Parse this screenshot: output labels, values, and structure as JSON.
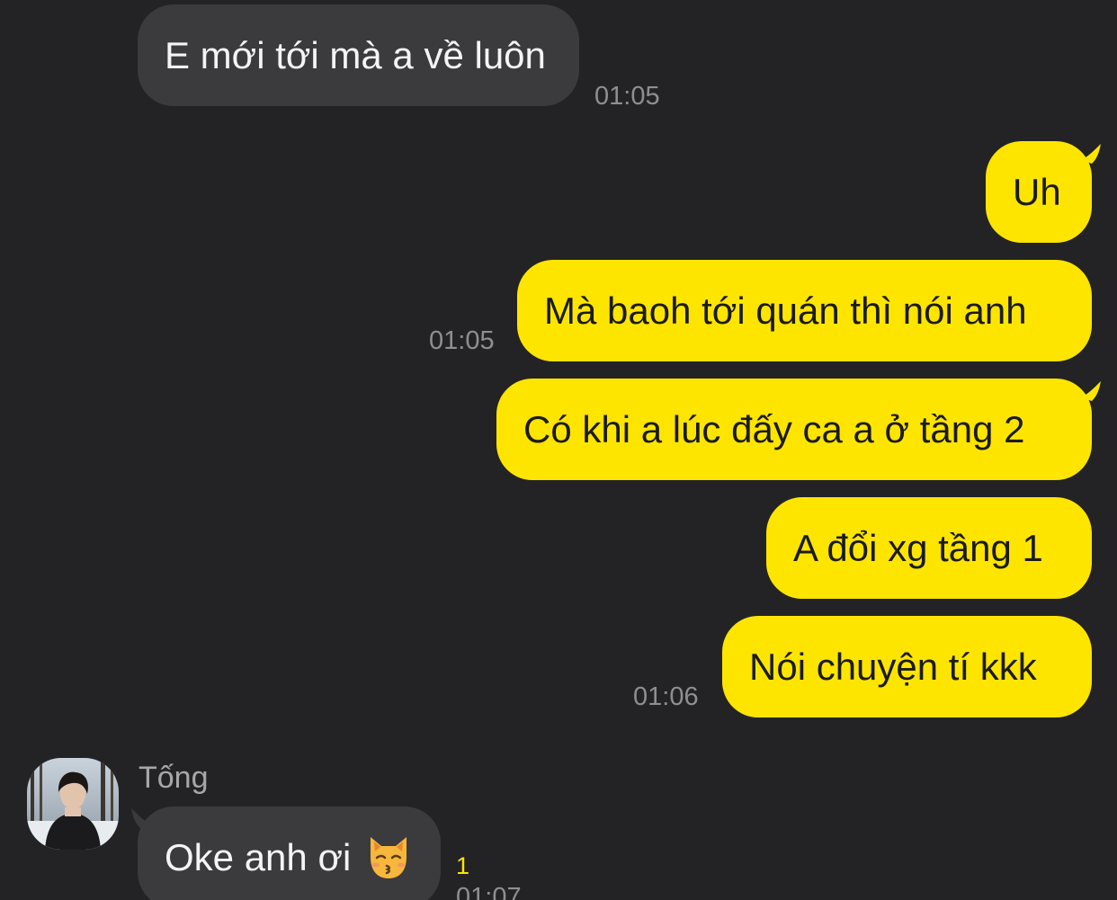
{
  "messages": {
    "m1": {
      "text": "E mới tới mà a về luôn",
      "time": "01:05"
    },
    "m2": {
      "text": "Uh"
    },
    "m3": {
      "text": "Mà baoh tới quán thì nói anh",
      "time": "01:05"
    },
    "m4": {
      "text": "Có khi a lúc đấy ca a ở tầng 2"
    },
    "m5": {
      "text": "A đổi xg tầng 1"
    },
    "m6": {
      "text": "Nói chuyện tí kkk",
      "time": "01:06"
    },
    "m7": {
      "sender": "Tống",
      "text": "Oke anh ơi",
      "emoji": "kissing-cat-emoji",
      "unread": "1",
      "time": "01:07"
    }
  },
  "colors": {
    "background": "#232325",
    "incoming_bubble": "#3b3b3e",
    "outgoing_bubble": "#fee500",
    "timestamp": "#8f8f93",
    "unread_count": "#fee500"
  }
}
